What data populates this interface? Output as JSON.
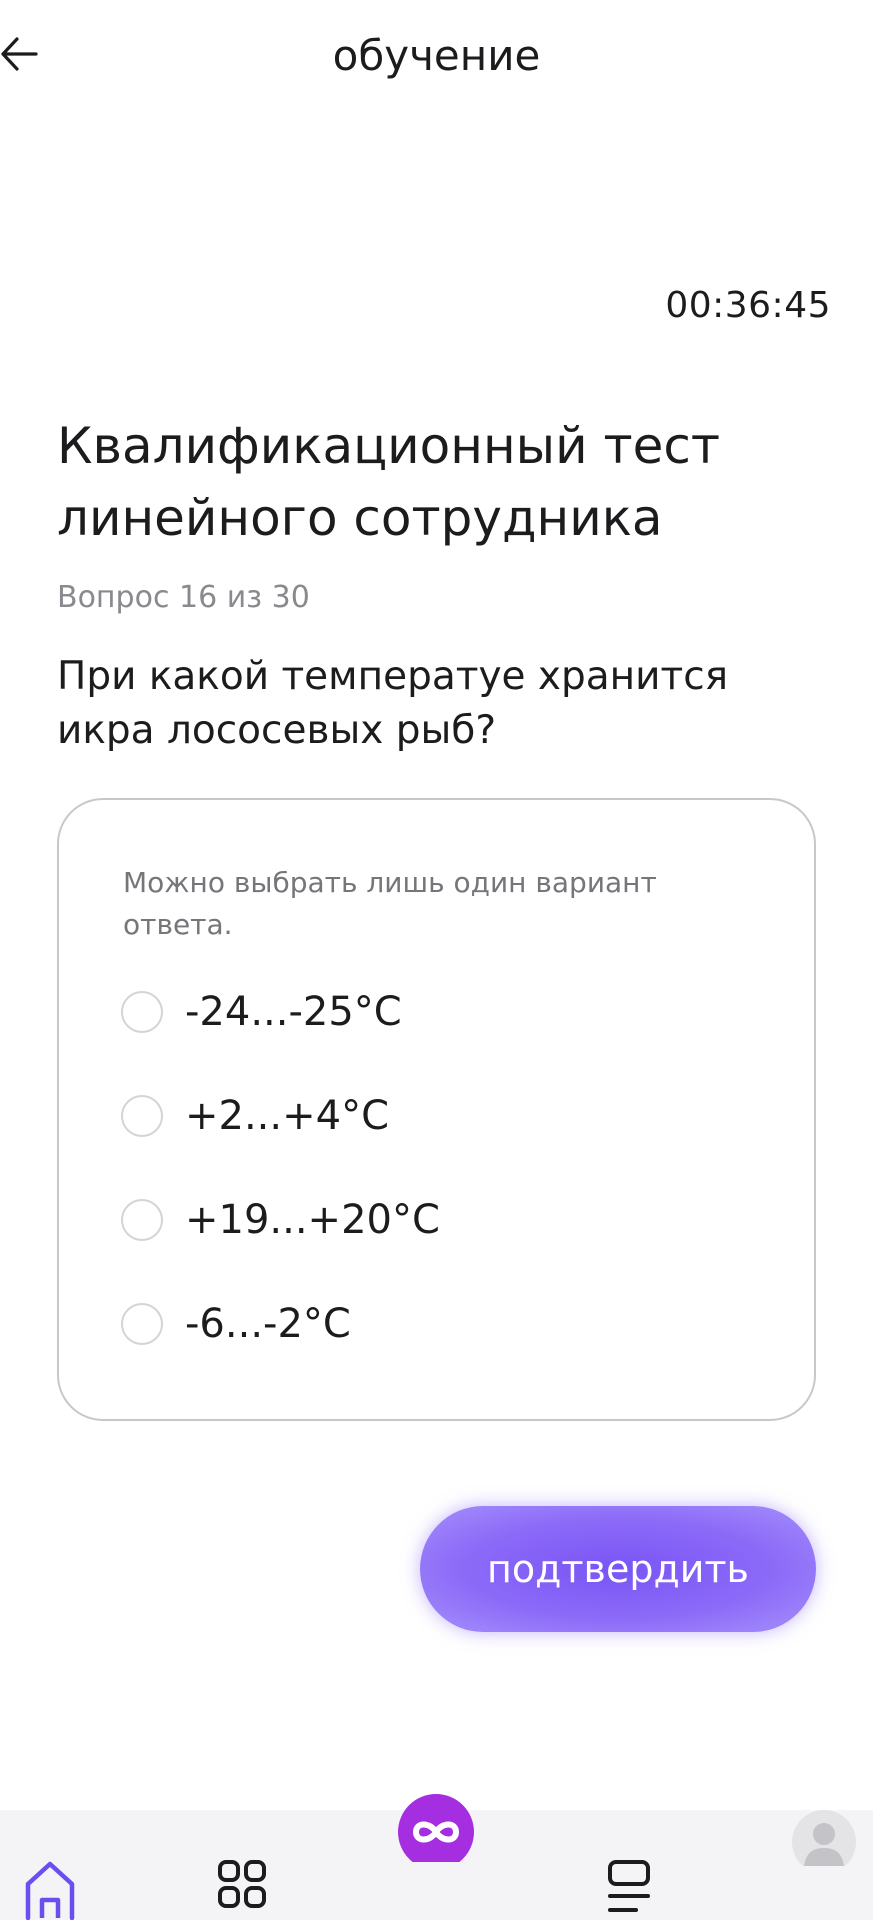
{
  "header": {
    "title": "обучение",
    "back_icon": "arrow-left-icon"
  },
  "timer": "00:36:45",
  "test": {
    "title": "Квалификационный тест линейного сотрудника",
    "counter": "Вопрос 16 из 30",
    "question": "При какой температуе хранится икра лососевых рыб?"
  },
  "answers": {
    "hint": "Можно выбрать лишь один вариант ответа.",
    "options": [
      {
        "label": "-24...-25°C",
        "selected": false
      },
      {
        "label": "+2...+4°C",
        "selected": false
      },
      {
        "label": "+19...+20°C",
        "selected": false
      },
      {
        "label": "-6...-2°C",
        "selected": false
      }
    ]
  },
  "confirm_label": "подтвердить",
  "nav": {
    "items": [
      {
        "icon": "home-icon",
        "active": true
      },
      {
        "icon": "apps-grid-icon",
        "active": false
      },
      {
        "icon": "infinity-logo-icon",
        "active": false
      },
      {
        "icon": "list-icon",
        "active": false
      },
      {
        "icon": "profile-avatar-icon",
        "active": false
      }
    ],
    "accent": "#6b4ef0",
    "logo_color": "#a42ee0"
  }
}
